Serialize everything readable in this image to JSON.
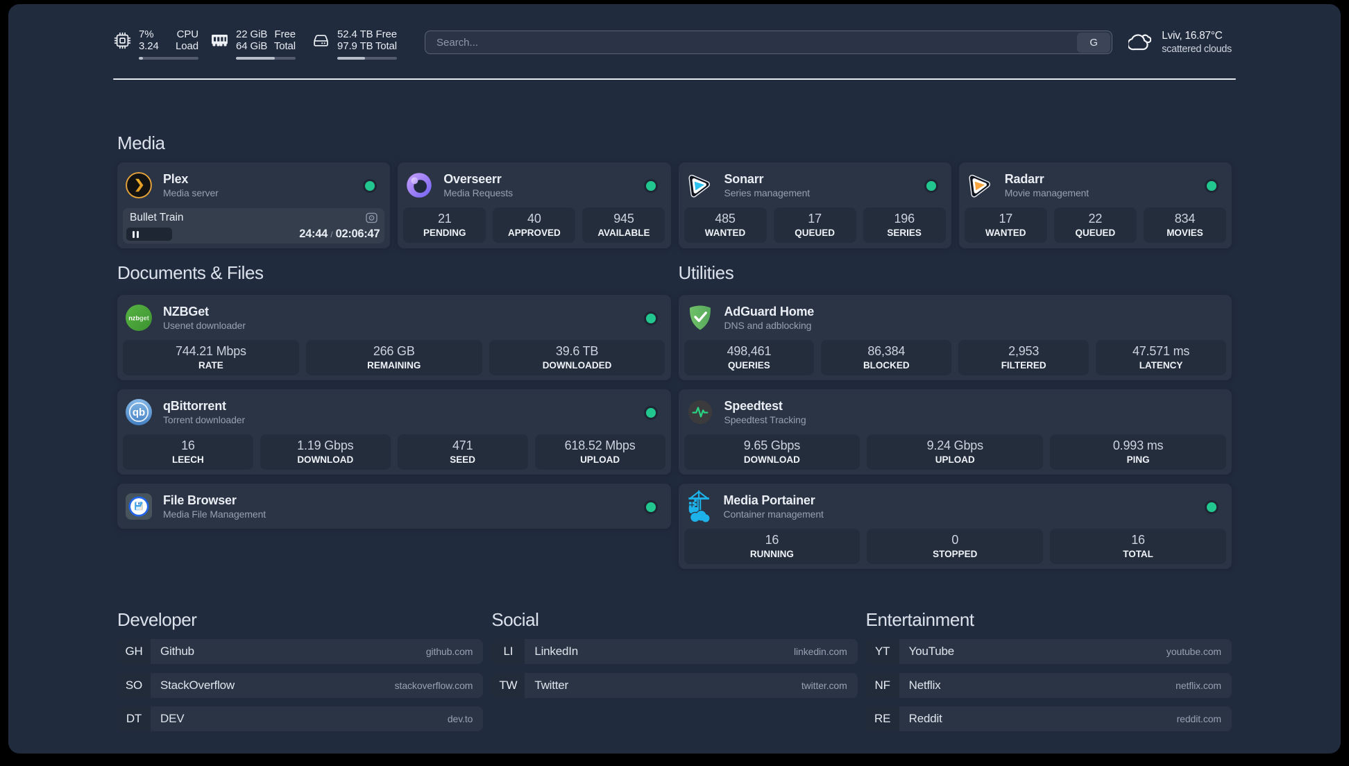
{
  "topbar": {
    "resources": [
      {
        "icon": "cpu-icon",
        "value1": "7%",
        "label1": "CPU",
        "value2": "3.24",
        "label2": "Load",
        "progress": 7
      },
      {
        "icon": "ram-icon",
        "value1": "22 GiB",
        "label1": "Free",
        "value2": "64 GiB",
        "label2": "Total",
        "progress": 65.6
      },
      {
        "icon": "disk-icon",
        "value1": "52.4 TB",
        "label1": "Free",
        "value2": "97.9 TB",
        "label2": "Total",
        "progress": 46.5
      }
    ],
    "search": {
      "placeholder": "Search...",
      "button_label": "G"
    },
    "weather": {
      "location_temp": "Lviv, 16.87°C",
      "condition": "scattered clouds"
    }
  },
  "groups": {
    "media": {
      "title": "Media"
    },
    "documents": {
      "title": "Documents & Files"
    },
    "utilities": {
      "title": "Utilities"
    }
  },
  "services": {
    "plex": {
      "name": "Plex",
      "desc": "Media server",
      "status": "online",
      "player": {
        "title": "Bullet Train",
        "position": "24:44",
        "separator": "/",
        "duration": "02:06:47"
      }
    },
    "overseerr": {
      "name": "Overseerr",
      "desc": "Media Requests",
      "status": "online",
      "stats": [
        {
          "value": "21",
          "label": "PENDING"
        },
        {
          "value": "40",
          "label": "APPROVED"
        },
        {
          "value": "945",
          "label": "AVAILABLE"
        }
      ]
    },
    "sonarr": {
      "name": "Sonarr",
      "desc": "Series management",
      "status": "online",
      "stats": [
        {
          "value": "485",
          "label": "WANTED"
        },
        {
          "value": "17",
          "label": "QUEUED"
        },
        {
          "value": "196",
          "label": "SERIES"
        }
      ]
    },
    "radarr": {
      "name": "Radarr",
      "desc": "Movie management",
      "status": "online",
      "stats": [
        {
          "value": "17",
          "label": "WANTED"
        },
        {
          "value": "22",
          "label": "QUEUED"
        },
        {
          "value": "834",
          "label": "MOVIES"
        }
      ]
    },
    "nzbget": {
      "name": "NZBGet",
      "desc": "Usenet downloader",
      "status": "online",
      "stats": [
        {
          "value": "744.21 Mbps",
          "label": "RATE"
        },
        {
          "value": "266 GB",
          "label": "REMAINING"
        },
        {
          "value": "39.6 TB",
          "label": "DOWNLOADED"
        }
      ]
    },
    "qbittorrent": {
      "name": "qBittorrent",
      "desc": "Torrent downloader",
      "status": "online",
      "stats": [
        {
          "value": "16",
          "label": "LEECH"
        },
        {
          "value": "1.19 Gbps",
          "label": "DOWNLOAD"
        },
        {
          "value": "471",
          "label": "SEED"
        },
        {
          "value": "618.52 Mbps",
          "label": "UPLOAD"
        }
      ]
    },
    "filebrowser": {
      "name": "File Browser",
      "desc": "Media File Management",
      "status": "online"
    },
    "adguard": {
      "name": "AdGuard Home",
      "desc": "DNS and adblocking",
      "stats": [
        {
          "value": "498,461",
          "label": "QUERIES"
        },
        {
          "value": "86,384",
          "label": "BLOCKED"
        },
        {
          "value": "2,953",
          "label": "FILTERED"
        },
        {
          "value": "47.571 ms",
          "label": "LATENCY"
        }
      ]
    },
    "speedtest": {
      "name": "Speedtest",
      "desc": "Speedtest Tracking",
      "stats": [
        {
          "value": "9.65 Gbps",
          "label": "DOWNLOAD"
        },
        {
          "value": "9.24 Gbps",
          "label": "UPLOAD"
        },
        {
          "value": "0.993 ms",
          "label": "PING"
        }
      ]
    },
    "portainer": {
      "name": "Media Portainer",
      "desc": "Container management",
      "status": "online",
      "stats": [
        {
          "value": "16",
          "label": "RUNNING"
        },
        {
          "value": "0",
          "label": "STOPPED"
        },
        {
          "value": "16",
          "label": "TOTAL"
        }
      ]
    }
  },
  "bookmarks": {
    "developer": {
      "title": "Developer",
      "items": [
        {
          "abbr": "GH",
          "name": "Github",
          "url": "github.com"
        },
        {
          "abbr": "SO",
          "name": "StackOverflow",
          "url": "stackoverflow.com"
        },
        {
          "abbr": "DT",
          "name": "DEV",
          "url": "dev.to"
        }
      ]
    },
    "social": {
      "title": "Social",
      "items": [
        {
          "abbr": "LI",
          "name": "LinkedIn",
          "url": "linkedin.com"
        },
        {
          "abbr": "TW",
          "name": "Twitter",
          "url": "twitter.com"
        }
      ]
    },
    "entertainment": {
      "title": "Entertainment",
      "items": [
        {
          "abbr": "YT",
          "name": "YouTube",
          "url": "youtube.com"
        },
        {
          "abbr": "NF",
          "name": "Netflix",
          "url": "netflix.com"
        },
        {
          "abbr": "RE",
          "name": "Reddit",
          "url": "reddit.com"
        }
      ]
    }
  },
  "colors": {
    "status_online": "#22c790",
    "accent_green": "#2ecc8f"
  }
}
